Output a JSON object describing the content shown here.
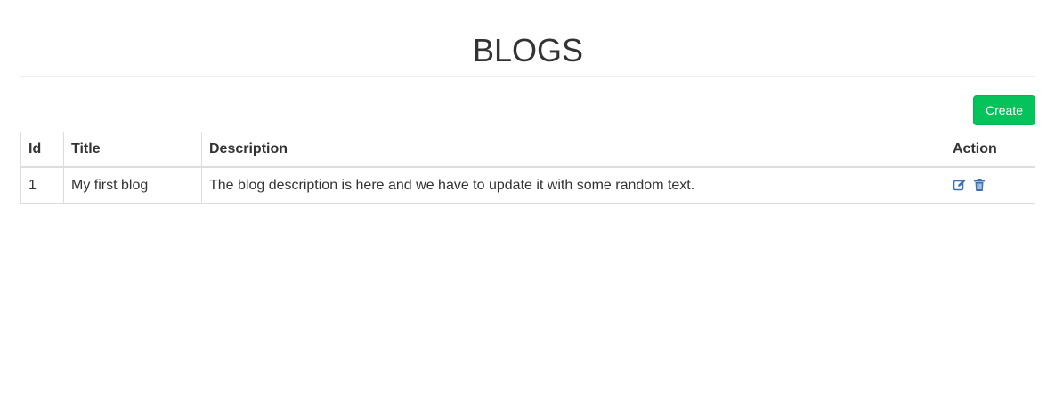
{
  "header": {
    "title": "BLOGS"
  },
  "toolbar": {
    "create_label": "Create"
  },
  "table": {
    "columns": [
      "Id",
      "Title",
      "Description",
      "Action"
    ],
    "rows": [
      {
        "id": "1",
        "title": "My first blog",
        "description": "The blog description is here and we have to update it with some random text.",
        "actions": [
          "edit-icon",
          "trash-icon"
        ]
      }
    ]
  },
  "colors": {
    "accent": "#04c35a",
    "icon": "#3b6fb6"
  }
}
